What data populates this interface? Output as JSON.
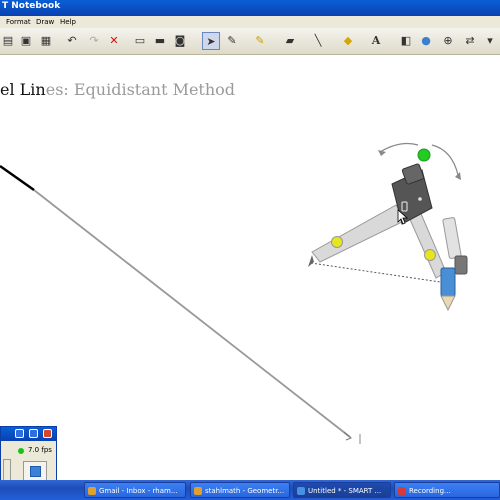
{
  "window": {
    "title": "T Notebook"
  },
  "menu": {
    "format": "Format",
    "draw": "Draw",
    "help": "Help"
  },
  "page": {
    "heading_dark": "el Lin",
    "heading_light": "es: Equidistant Method"
  },
  "recorder": {
    "fps": "7.0 fps"
  },
  "taskbar": {
    "items": [
      {
        "label": "Gmail - Inbox - rham...",
        "icon_color": "#e0a030"
      },
      {
        "label": "stahlmath - Geometr...",
        "icon_color": "#e0a030"
      },
      {
        "label": "Untitled * - SMART ...",
        "icon_color": "#4a90e2"
      },
      {
        "label": "Recording...",
        "icon_color": "#d43c3c"
      }
    ]
  },
  "colors": {
    "accent": "#0a5fd6",
    "compass_green": "#22cc22",
    "compass_joint": "#e6e61e",
    "pencil_blue": "#4a8fd6"
  }
}
